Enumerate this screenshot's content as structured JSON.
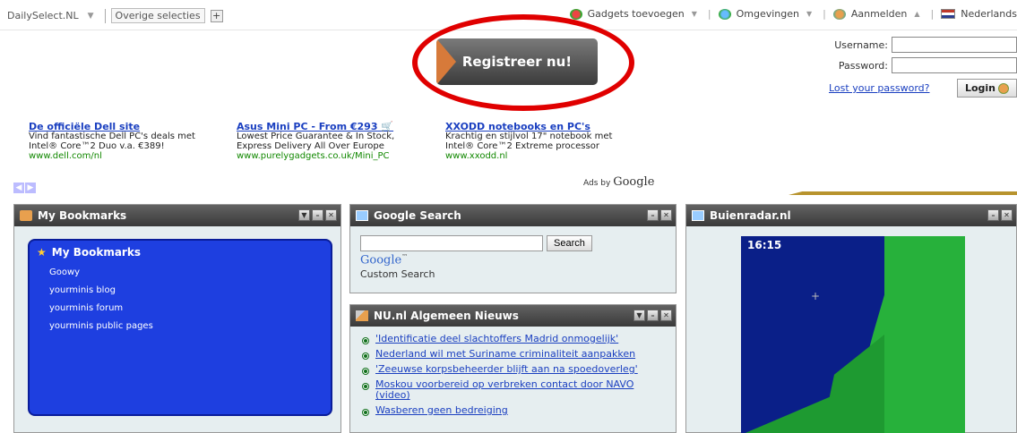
{
  "topbar": {
    "site": "DailySelect.NL",
    "other": "Overige selecties",
    "gadgets": "Gadgets toevoegen",
    "environments": "Omgevingen",
    "signin": "Aanmelden",
    "language": "Nederlands"
  },
  "register": {
    "label": "Registreer nu!"
  },
  "login": {
    "username_label": "Username:",
    "password_label": "Password:",
    "username_value": "",
    "password_value": "",
    "lost_link": "Lost your password?",
    "button": "Login"
  },
  "ads": [
    {
      "title": "De officiële Dell site",
      "line1": "Vind fantastische Dell PC's deals met",
      "line2": "Intel® Core™2 Duo v.a. €389!",
      "url": "www.dell.com/nl"
    },
    {
      "title": "Asus Mini PC - From €293",
      "line1": "Lowest Price Guarantee & In Stock,",
      "line2": "Express Delivery All Over Europe",
      "url": "www.purelygadgets.co.uk/Mini_PC"
    },
    {
      "title": "XXODD notebooks en PC's",
      "line1": "Krachtig en stijlvol 17\" notebook met",
      "line2": "Intel® Core™2 Extreme processor",
      "url": "www.xxodd.nl"
    }
  ],
  "ads_by": "Ads by",
  "ads_brand": "Google",
  "bookmarks": {
    "panel_title": "My Bookmarks",
    "inner_title": "My Bookmarks",
    "items": [
      "Goowy",
      "yourminis blog",
      "yourminis forum",
      "yourminis public pages"
    ]
  },
  "google_search": {
    "panel_title": "Google Search",
    "button": "Search",
    "logo": "Google",
    "caption": "Custom Search"
  },
  "news": {
    "panel_title": "NU.nl Algemeen Nieuws",
    "items": [
      "'Identificatie deel slachtoffers Madrid onmogelijk'",
      "Nederland wil met Suriname criminaliteit aanpakken",
      "'Zeeuwse korpsbeheerder blijft aan na spoedoverleg'",
      "Moskou voorbereid op verbreken contact door NAVO (video)",
      "Wasberen geen bedreiging"
    ]
  },
  "buienradar": {
    "panel_title": "Buienradar.nl",
    "time": "16:15"
  },
  "colors": {
    "accent_red": "#e00000",
    "panel_header": "#3a3a3a",
    "bookmark_blue": "#1e3fe0",
    "link": "#1a3fc0"
  }
}
